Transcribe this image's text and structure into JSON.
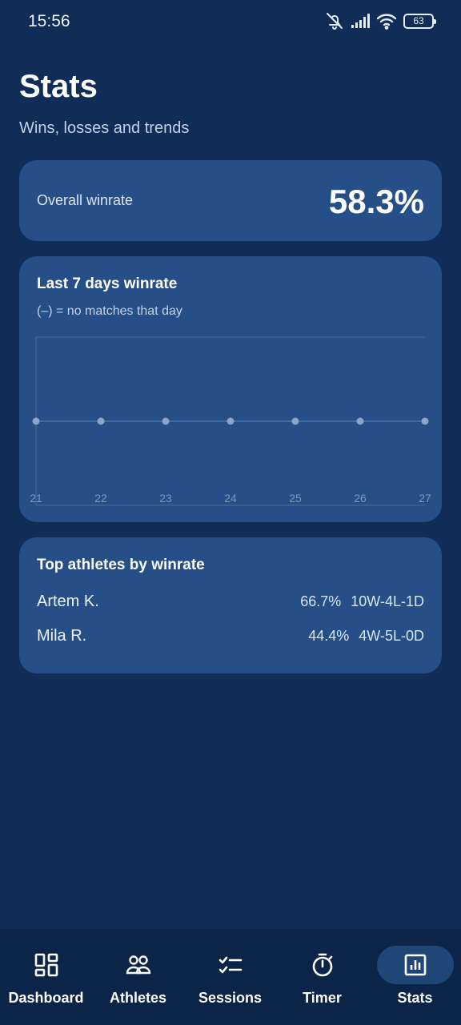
{
  "status_bar": {
    "time": "15:56",
    "battery_level": "63",
    "icons": [
      "mute-icon",
      "signal-icon",
      "wifi-icon",
      "battery-icon"
    ]
  },
  "header": {
    "title": "Stats",
    "subtitle": "Wins, losses and trends"
  },
  "overall": {
    "label": "Overall winrate",
    "value": "58.3%"
  },
  "chart_card": {
    "title": "Last 7 days winrate",
    "note": "(–) = no matches that day"
  },
  "chart_data": {
    "type": "line",
    "title": "Last 7 days winrate",
    "x": [
      "21",
      "22",
      "23",
      "24",
      "25",
      "26",
      "27"
    ],
    "series": [
      {
        "values": [
          null,
          null,
          null,
          null,
          null,
          null,
          null
        ]
      }
    ],
    "ylim": [
      0,
      100
    ],
    "grid": false
  },
  "athletes": {
    "title": "Top athletes by winrate",
    "rows": [
      {
        "name": "Artem K.",
        "winrate": "66.7%",
        "record": "10W-4L-1D"
      },
      {
        "name": "Mila R.",
        "winrate": "44.4%",
        "record": "4W-5L-0D"
      }
    ]
  },
  "nav": {
    "items": [
      {
        "label": "Dashboard",
        "icon": "dashboard-icon",
        "active": false
      },
      {
        "label": "Athletes",
        "icon": "athletes-icon",
        "active": false
      },
      {
        "label": "Sessions",
        "icon": "sessions-icon",
        "active": false
      },
      {
        "label": "Timer",
        "icon": "timer-icon",
        "active": false
      },
      {
        "label": "Stats",
        "icon": "stats-icon",
        "active": true
      }
    ]
  },
  "colors": {
    "background": "#0f2d57",
    "card": "#254f86",
    "nav_background": "#0c2447",
    "nav_active_pill": "#1f4677",
    "chart_point": "#8da6c6"
  }
}
